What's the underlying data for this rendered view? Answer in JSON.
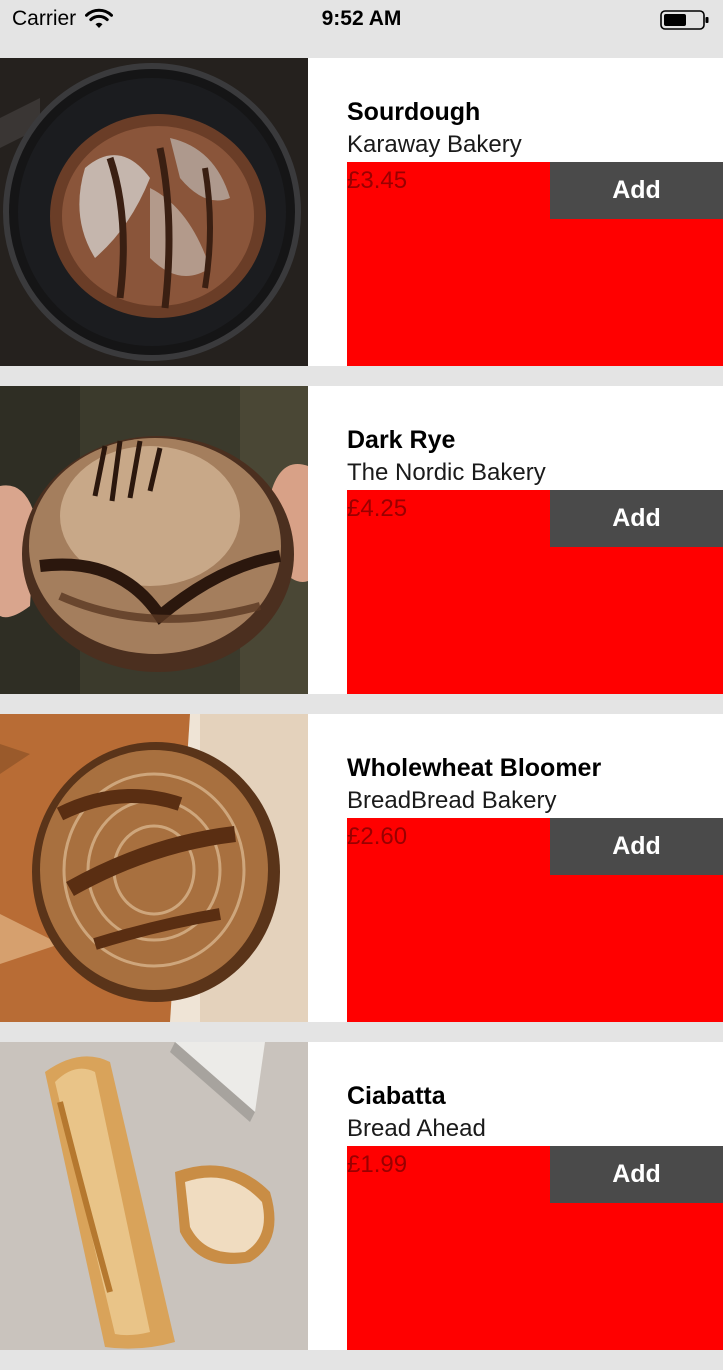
{
  "status_bar": {
    "carrier": "Carrier",
    "time": "9:52 AM"
  },
  "products": [
    {
      "name": "Sourdough",
      "bakery": "Karaway Bakery",
      "price": "£3.45",
      "add_label": "Add"
    },
    {
      "name": "Dark Rye",
      "bakery": "The Nordic Bakery",
      "price": "£4.25",
      "add_label": "Add"
    },
    {
      "name": "Wholewheat Bloomer",
      "bakery": "BreadBread Bakery",
      "price": "£2.60",
      "add_label": "Add"
    },
    {
      "name": "Ciabatta",
      "bakery": "Bread Ahead",
      "price": "£1.99",
      "add_label": "Add"
    }
  ],
  "colors": {
    "background": "#e4e4e4",
    "price_panel": "#ff0000",
    "price_text": "#990000",
    "add_button": "#4a4a4a",
    "add_button_text": "#ffffff"
  },
  "icons": {
    "wifi": "wifi-icon",
    "battery": "battery-icon"
  }
}
